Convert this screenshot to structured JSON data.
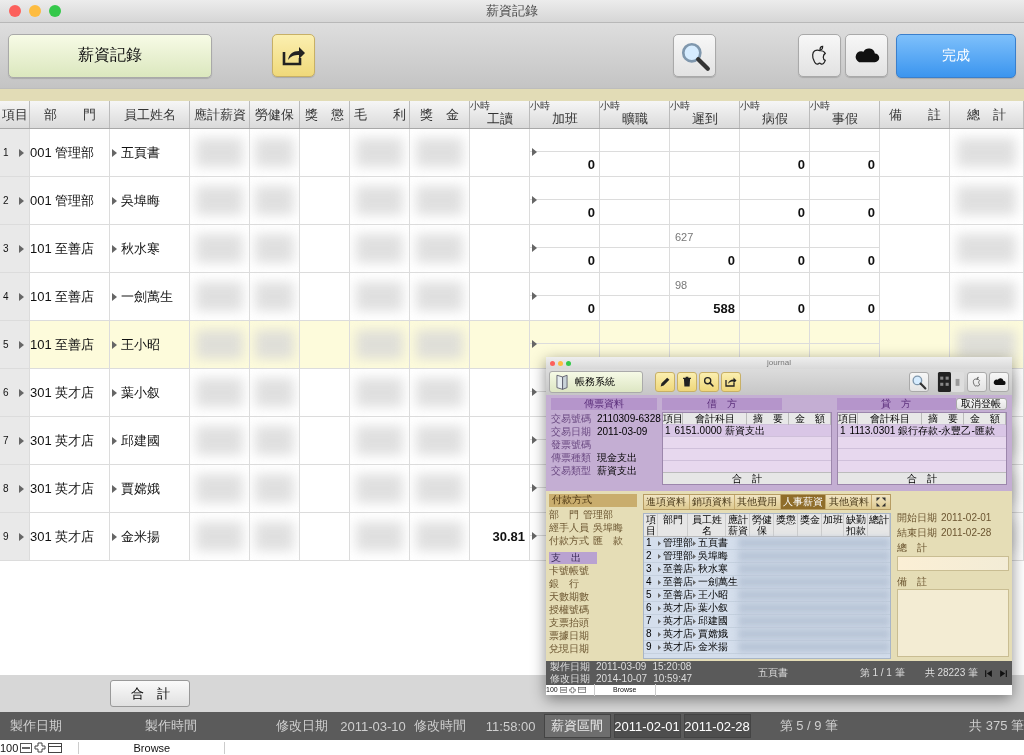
{
  "window": {
    "title": "薪資記錄"
  },
  "toolbar": {
    "layout_button": "薪資記錄",
    "done_button": "完成"
  },
  "table": {
    "columns": [
      {
        "label": "項目",
        "kind": "index"
      },
      {
        "label": "部　　門",
        "kind": "department"
      },
      {
        "label": "員工姓名",
        "kind": "name"
      },
      {
        "label": "應計薪資",
        "kind": "blurred"
      },
      {
        "label": "勞健保",
        "kind": "blurred"
      },
      {
        "label": "獎　懲",
        "kind": "empty"
      },
      {
        "label": "毛　　利",
        "kind": "blurred"
      },
      {
        "label": "獎　金",
        "kind": "blurred"
      },
      {
        "label": "工讀",
        "unit": "小時",
        "kind": "part_time"
      },
      {
        "label": "加班",
        "unit": "小時",
        "kind": "overtime"
      },
      {
        "label": "曠職",
        "unit": "小時",
        "kind": "absence"
      },
      {
        "label": "遲到",
        "unit": "小時",
        "kind": "late"
      },
      {
        "label": "病假",
        "unit": "小時",
        "kind": "sick"
      },
      {
        "label": "事假",
        "unit": "小時",
        "kind": "personal"
      },
      {
        "label": "備　　註",
        "kind": "empty"
      },
      {
        "label": "總　計",
        "kind": "blurred"
      }
    ],
    "rows": [
      {
        "no": "1",
        "department": "001 管理部",
        "name": "五頁書",
        "selected": false,
        "overtime": {
          "value": "0"
        },
        "sick": {
          "value": "0"
        },
        "personal": {
          "value": "0"
        }
      },
      {
        "no": "2",
        "department": "001 管理部",
        "name": "吳埠晦",
        "selected": false,
        "overtime": {
          "value": "0"
        },
        "sick": {
          "value": "0"
        },
        "personal": {
          "value": "0"
        }
      },
      {
        "no": "3",
        "department": "101 至善店",
        "name": "秋水寒",
        "selected": false,
        "overtime": {
          "value": "0"
        },
        "late": {
          "note": "627",
          "value": "0"
        },
        "sick": {
          "value": "0"
        },
        "personal": {
          "value": "0"
        }
      },
      {
        "no": "4",
        "department": "101 至善店",
        "name": "一劍萬生",
        "selected": false,
        "overtime": {
          "value": "0"
        },
        "late": {
          "note": "98",
          "value": "588"
        },
        "sick": {
          "value": "0"
        },
        "personal": {
          "value": "0"
        }
      },
      {
        "no": "5",
        "department": "101 至善店",
        "name": "王小昭",
        "selected": true
      },
      {
        "no": "6",
        "department": "301 英才店",
        "name": "葉小叙",
        "selected": false
      },
      {
        "no": "7",
        "department": "301 英才店",
        "name": "邱建國",
        "selected": false
      },
      {
        "no": "8",
        "department": "301 英才店",
        "name": "賈嫦娥",
        "selected": false
      },
      {
        "no": "9",
        "department": "301 英才店",
        "name": "金米揚",
        "selected": false,
        "part_time": "30.81"
      }
    ]
  },
  "total_button": "合　計",
  "status_bar": {
    "created_label": "製作日期",
    "created_time_label": "製作時間",
    "modified_label": "修改日期",
    "modified_date": "2011-03-10",
    "modified_time_label": "修改時間",
    "modified_time": "11:58:00",
    "period_label": "薪資區間",
    "period_start": "2011-02-01",
    "period_end": "2011-02-28",
    "record": "第 5 / 9 筆",
    "total": "共 375 筆"
  },
  "browse_bar": {
    "zoom": "100",
    "mode": "Browse"
  },
  "journal_window": {
    "title": "journal",
    "app_button": "帳務系統",
    "voucher": {
      "header": "傳票資料",
      "fields": [
        {
          "label": "交易號碼",
          "value": "2110309-6328"
        },
        {
          "label": "交易日期",
          "value": "2011-03-09"
        },
        {
          "label": "發票號碼"
        },
        {
          "label": "傳票種類",
          "value": "現金支出"
        },
        {
          "label": "交易類型",
          "value": "薪資支出"
        }
      ]
    },
    "debit": {
      "header": "借　方",
      "columns": [
        "項目",
        "會計科目",
        "摘　要",
        "金　額"
      ],
      "rows": [
        {
          "no": "1",
          "account": "6151.0000 薪資支出"
        }
      ],
      "total": "合　計"
    },
    "credit": {
      "header": "貸　方",
      "columns": [
        "項目",
        "會計科目",
        "摘　要",
        "金　額"
      ],
      "rows": [
        {
          "no": "1",
          "account": "1113.0301 銀行存款-永豐乙-匯款"
        }
      ],
      "total": "合　計"
    },
    "cancel_button": "取消登帳",
    "payment": {
      "header": "付款方式",
      "fields": [
        {
          "label": "部　門",
          "value": "管理部"
        },
        {
          "label": "經手人員",
          "value": "吳埠晦"
        },
        {
          "label": "付款方式",
          "value": "匯　款"
        }
      ],
      "expense": "支　出",
      "details": [
        "卡號帳號",
        "銀　行",
        "天數期數",
        "授權號碼",
        "支票抬頭",
        "票據日期",
        "兌現日期"
      ]
    },
    "tabs": [
      {
        "label": "進項資料",
        "selected": false
      },
      {
        "label": "銷項資料",
        "selected": false
      },
      {
        "label": "其他費用",
        "selected": false
      },
      {
        "label": "人事薪資",
        "selected": true
      },
      {
        "label": "其他資料",
        "selected": false
      }
    ],
    "payroll": {
      "columns": [
        "項目",
        "部門",
        "員工姓名",
        "應計薪資",
        "勞健保",
        "獎懲",
        "獎金",
        "加班",
        "缺勤扣款",
        "總計"
      ],
      "rows": [
        {
          "no": "1",
          "department": "管理部",
          "name": "五頁書"
        },
        {
          "no": "2",
          "department": "管理部",
          "name": "吳埠晦"
        },
        {
          "no": "3",
          "department": "至善店",
          "name": "秋水寒"
        },
        {
          "no": "4",
          "department": "至善店",
          "name": "一劍萬生"
        },
        {
          "no": "5",
          "department": "至善店",
          "name": "王小昭"
        },
        {
          "no": "6",
          "department": "英才店",
          "name": "葉小叙"
        },
        {
          "no": "7",
          "department": "英才店",
          "name": "邱建國"
        },
        {
          "no": "8",
          "department": "英才店",
          "name": "賈嫦娥"
        },
        {
          "no": "9",
          "department": "英才店",
          "name": "金米揚"
        }
      ]
    },
    "period": [
      {
        "label": "開始日期",
        "value": "2011-02-01",
        "kind": "text"
      },
      {
        "label": "結束日期",
        "value": "2011-02-28",
        "kind": "text"
      },
      {
        "label": "總　計",
        "kind": "field"
      },
      {
        "label": "備　註",
        "kind": "memo"
      }
    ],
    "footer": {
      "created_label": "製作日期",
      "created_date": "2011-03-09",
      "created_time": "15:20:08",
      "modified_label": "修改日期",
      "modified_date": "2014-10-07",
      "modified_time": "10:59:47",
      "current": "五頁書",
      "record": "第 1 / 1 筆",
      "total": "共 28223 筆"
    },
    "browse_bar": {
      "zoom": "100",
      "mode": "Browse"
    }
  }
}
